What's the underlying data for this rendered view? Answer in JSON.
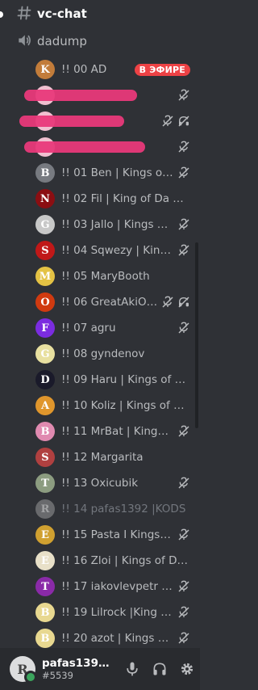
{
  "text_channel": {
    "name": "vc-chat"
  },
  "voice_channel": {
    "name": "dadump"
  },
  "live_label": "В ЭФИРЕ",
  "users": [
    {
      "name": "!! 00 AD",
      "avatar": "K",
      "color": "#c27c3a",
      "icons": [],
      "live": true
    },
    {
      "name": "",
      "avatar": "",
      "color": "#f0c0d0",
      "icons": [
        "mute"
      ],
      "redacted": true
    },
    {
      "name": "",
      "avatar": "",
      "color": "#f0c0d0",
      "icons": [
        "mute",
        "deafen"
      ],
      "redacted": true
    },
    {
      "name": "",
      "avatar": "",
      "color": "#f0c0d0",
      "icons": [
        "mute"
      ],
      "redacted": true
    },
    {
      "name": "!! 01 Ben | Kings of ...",
      "avatar": "B",
      "color": "#777a80",
      "icons": [
        "mute"
      ]
    },
    {
      "name": "!! 02 Fil | King of Da Street",
      "avatar": "N",
      "color": "#8b0e12",
      "icons": []
    },
    {
      "name": "!! 03 Jallo | Kings of ...",
      "avatar": "G",
      "color": "#c8c8c8",
      "icons": [
        "mute"
      ]
    },
    {
      "name": "!! 04 Sqwezy | King ...",
      "avatar": "S",
      "color": "#c01818",
      "icons": [
        "mute"
      ]
    },
    {
      "name": "!! 05 MaryBooth",
      "avatar": "M",
      "color": "#e4c244",
      "icons": []
    },
    {
      "name": "!! 06 GreatAkiO ...",
      "avatar": "O",
      "color": "#d03a10",
      "icons": [
        "mute",
        "deafen"
      ]
    },
    {
      "name": "!! 07 agru",
      "avatar": "F",
      "color": "#7b2ce0",
      "icons": [
        "mute"
      ]
    },
    {
      "name": "!! 08 gyndenov",
      "avatar": "G",
      "color": "#e8e0a0",
      "icons": []
    },
    {
      "name": "!! 09 Haru | Kings of Da ...",
      "avatar": "D",
      "color": "#1a1a2a",
      "icons": []
    },
    {
      "name": "!! 10 Koliz | Kings of Da S...",
      "avatar": "A",
      "color": "#e0962c",
      "icons": []
    },
    {
      "name": "!! 11 MrBat | Kings o...",
      "avatar": "B",
      "color": "#e08ab0",
      "icons": [
        "mute"
      ]
    },
    {
      "name": "!! 12 Margarita",
      "avatar": "S",
      "color": "#b04040",
      "icons": []
    },
    {
      "name": "!! 13 Oxicubik",
      "avatar": "T",
      "color": "#8c9c80",
      "icons": [
        "mute"
      ]
    },
    {
      "name": "!! 14 pafas1392 |KODS",
      "avatar": "R",
      "color": "#9a9a9a",
      "icons": [],
      "faded": true
    },
    {
      "name": "!! 15 Pasta I Kings of...",
      "avatar": "E",
      "color": "#d0a030",
      "icons": [
        "mute"
      ]
    },
    {
      "name": "!! 16 Zloi | Kings of Da St...",
      "avatar": "E",
      "color": "#e8e0c8",
      "icons": []
    },
    {
      "name": "!! 17 iakovlevpetr | K...",
      "avatar": "T",
      "color": "#8a2aa8",
      "icons": [
        "mute"
      ]
    },
    {
      "name": "!! 19 Lilrock |King of da S...",
      "avatar": "B",
      "color": "#e8d890",
      "icons": [
        "mute"
      ]
    },
    {
      "name": "!! 20 azot | Kings of ...",
      "avatar": "B",
      "color": "#e8d890",
      "icons": [
        "mute"
      ]
    }
  ],
  "panel": {
    "username": "pafas1392 I ...",
    "tag": "#5539",
    "avatar": "R"
  }
}
